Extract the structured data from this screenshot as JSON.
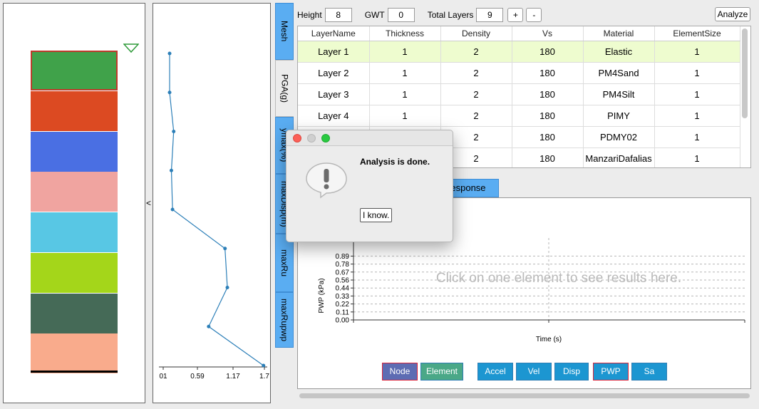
{
  "soil_column": {
    "layers": [
      {
        "color": "#40a24a",
        "border": "#c0392b"
      },
      {
        "color": "#dc4a22"
      },
      {
        "color": "#4a6fe3"
      },
      {
        "color": "#f0a4a0"
      },
      {
        "color": "#58c7e4"
      },
      {
        "color": "#a4d61a"
      },
      {
        "color": "#456a57"
      },
      {
        "color": "#f9ab8c"
      }
    ],
    "gwt_marker_color": "#2e9a39"
  },
  "collapse_arrow": "<",
  "profile": {
    "x_ticks": [
      "01",
      "0.59",
      "1.17",
      "1.7"
    ],
    "x_range": [
      0,
      1.76
    ],
    "depth_range": [
      0,
      8
    ],
    "points": [
      {
        "x": 0.11,
        "depth": 0
      },
      {
        "x": 0.11,
        "depth": 1
      },
      {
        "x": 0.18,
        "depth": 2
      },
      {
        "x": 0.14,
        "depth": 3
      },
      {
        "x": 0.16,
        "depth": 4
      },
      {
        "x": 1.06,
        "depth": 5
      },
      {
        "x": 1.1,
        "depth": 6
      },
      {
        "x": 0.78,
        "depth": 7
      },
      {
        "x": 1.72,
        "depth": 8
      }
    ],
    "line_color": "#2c7fb8"
  },
  "tabs": [
    {
      "label": "Mesh",
      "active": false
    },
    {
      "label": "PGA(g)",
      "active": true
    },
    {
      "label": "ymax(%)",
      "active": false
    },
    {
      "label": "maxDisp(m)",
      "active": false
    },
    {
      "label": "maxRu",
      "active": false
    },
    {
      "label": "maxRupwp",
      "active": false
    }
  ],
  "controls": {
    "height_label": "Height",
    "height_value": "8",
    "gwt_label": "GWT",
    "gwt_value": "0",
    "total_layers_label": "Total Layers",
    "total_layers_value": "9",
    "plus_label": "+",
    "minus_label": "-",
    "analyze_label": "Analyze"
  },
  "table": {
    "headers": [
      "LayerName",
      "Thickness",
      "Density",
      "Vs",
      "Material",
      "ElementSize"
    ],
    "rows": [
      [
        "Layer 1",
        "1",
        "2",
        "180",
        "Elastic",
        "1"
      ],
      [
        "Layer 2",
        "1",
        "2",
        "180",
        "PM4Sand",
        "1"
      ],
      [
        "Layer 3",
        "1",
        "2",
        "180",
        "PM4Silt",
        "1"
      ],
      [
        "Layer 4",
        "1",
        "2",
        "180",
        "PIMY",
        "1"
      ],
      [
        "",
        "",
        "2",
        "180",
        "PDMY02",
        "1"
      ],
      [
        "",
        "",
        "2",
        "180",
        "ManzariDafalias",
        "1"
      ]
    ]
  },
  "response_tab_label": "Response",
  "chart": {
    "ylabel": "PWP (kPa)",
    "xlabel": "Time (s)",
    "y_ticks": [
      "0.00",
      "0.11",
      "0.22",
      "0.33",
      "0.44",
      "0.56",
      "0.67",
      "0.78",
      "0.89"
    ],
    "placeholder": "Click on one element to see results here."
  },
  "bottom_buttons": [
    {
      "label": "Node",
      "color": "#5d6cb3",
      "selected": true
    },
    {
      "label": "Element",
      "color": "#4aa887",
      "selected": false
    },
    {
      "label": "Accel",
      "color": "#1c96d1",
      "selected": false
    },
    {
      "label": "Vel",
      "color": "#1c96d1",
      "selected": false
    },
    {
      "label": "Disp",
      "color": "#1c96d1",
      "selected": false
    },
    {
      "label": "PWP",
      "color": "#1c96d1",
      "selected": true
    },
    {
      "label": "Sa",
      "color": "#1c96d1",
      "selected": false
    }
  ],
  "dialog": {
    "message": "Analysis is done.",
    "ok_label": "I know."
  }
}
